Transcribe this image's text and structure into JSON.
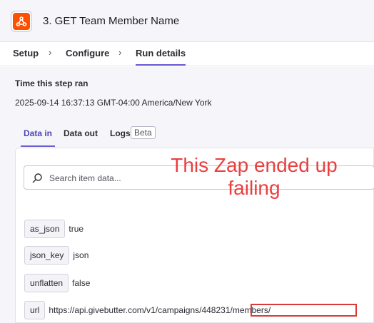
{
  "header": {
    "step_title": "3. GET Team Member Name",
    "app_icon": "webhook-icon",
    "accent": "#ff4f00"
  },
  "breadcrumb": {
    "items": [
      "Setup",
      "Configure",
      "Run details"
    ],
    "active": "Run details"
  },
  "run_info": {
    "label": "Time this step ran",
    "value": "2025-09-14 16:37:13 GMT-04:00 America/New York"
  },
  "tabs": {
    "data_in": "Data in",
    "data_out": "Data out",
    "logs": "Logs",
    "beta": "Beta",
    "active": "Data in",
    "accent": "#6b5fd3"
  },
  "search": {
    "placeholder": "Search item data..."
  },
  "items": [
    {
      "key": "as_json",
      "value": "true"
    },
    {
      "key": "json_key",
      "value": "json"
    },
    {
      "key": "unflatten",
      "value": "false"
    },
    {
      "key": "url",
      "value": "https://api.givebutter.com/v1/campaigns/448231/members/"
    }
  ],
  "annotation": {
    "text": "This Zap ended up failing",
    "color": "#e8403f"
  }
}
